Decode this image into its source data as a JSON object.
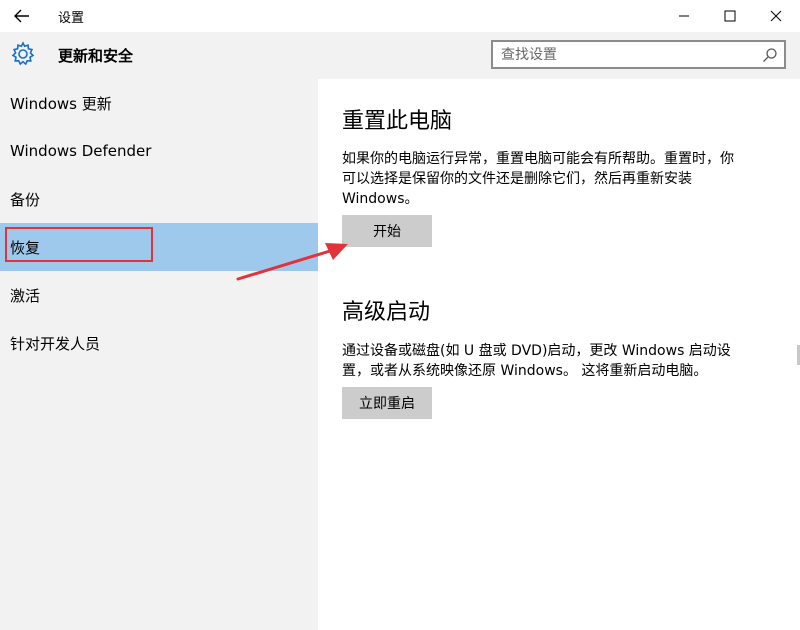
{
  "window": {
    "title": "设置",
    "section_title": "更新和安全"
  },
  "search": {
    "placeholder": "查找设置"
  },
  "nav": {
    "items": [
      {
        "label": "Windows 更新"
      },
      {
        "label": "Windows Defender"
      },
      {
        "label": "备份"
      },
      {
        "label": "恢复",
        "selected": true
      },
      {
        "label": "激活"
      },
      {
        "label": "针对开发人员"
      }
    ]
  },
  "reset": {
    "heading": "重置此电脑",
    "line1": "如果你的电脑运行异常，重置电脑可能会有所帮助。重置时，你",
    "line2": "可以选择是保留你的文件还是删除它们，然后再重新安装",
    "line3": "Windows。",
    "button": "开始"
  },
  "advanced": {
    "heading": "高级启动",
    "line1": "通过设备或磁盘(如 U 盘或 DVD)启动，更改 Windows 启动设",
    "line2": "置，或者从系统映像还原 Windows。 这将重新启动电脑。",
    "button": "立即重启"
  },
  "colors": {
    "selected_bg": "#9fc9ec",
    "highlight_border": "#e2333a",
    "arrow": "#e2333a",
    "pane_bg": "#f2f2f2",
    "button_bg": "#cccccc"
  },
  "icons": [
    "back-arrow-icon",
    "minimize-icon",
    "maximize-icon",
    "close-icon",
    "gear-icon",
    "search-icon"
  ]
}
